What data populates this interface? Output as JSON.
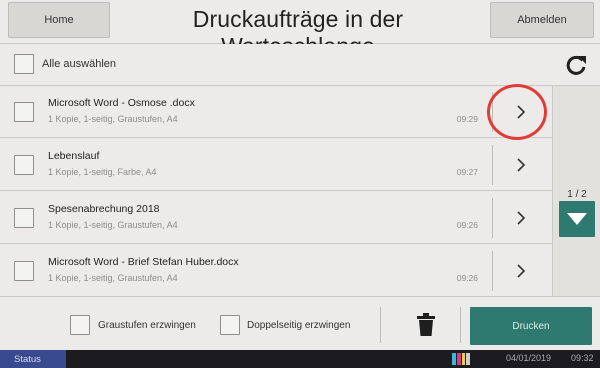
{
  "header": {
    "home_label": "Home",
    "title": "Druckaufträge in der Warteschlange",
    "logout_label": "Abmelden"
  },
  "selection": {
    "select_all_label": "Alle auswählen",
    "refresh_icon": "refresh-icon"
  },
  "jobs": [
    {
      "name": "Microsoft Word - Osmose .docx",
      "details": "1 Kopie, 1-seitig, Graustufen, A4",
      "time": "09:29",
      "highlighted": true
    },
    {
      "name": "Lebenslauf",
      "details": "1 Kopie, 1-seitig, Farbe, A4",
      "time": "09:27"
    },
    {
      "name": "Spesenabrechung 2018",
      "details": "1 Kopie, 1-seitig, Graustufen, A4",
      "time": "09:26"
    },
    {
      "name": "Microsoft Word - Brief Stefan Huber.docx",
      "details": "1 Kopie, 1-seitig, Graustufen, A4",
      "time": "09:26"
    }
  ],
  "pager": {
    "indicator": "1 / 2",
    "down_icon": "triangle-down-icon"
  },
  "footer": {
    "force_grayscale_label": "Graustufen erzwingen",
    "force_duplex_label": "Doppelseitig erzwingen",
    "delete_icon": "trash-icon",
    "print_label": "Drucken"
  },
  "statusbar": {
    "status_label": "Status",
    "date": "04/01/2019",
    "time": "09:32"
  },
  "colors": {
    "accent": "#2f7a70",
    "highlight_ring": "#e23a35",
    "status_button": "#3a4a8e",
    "background": "#ecebe9"
  }
}
